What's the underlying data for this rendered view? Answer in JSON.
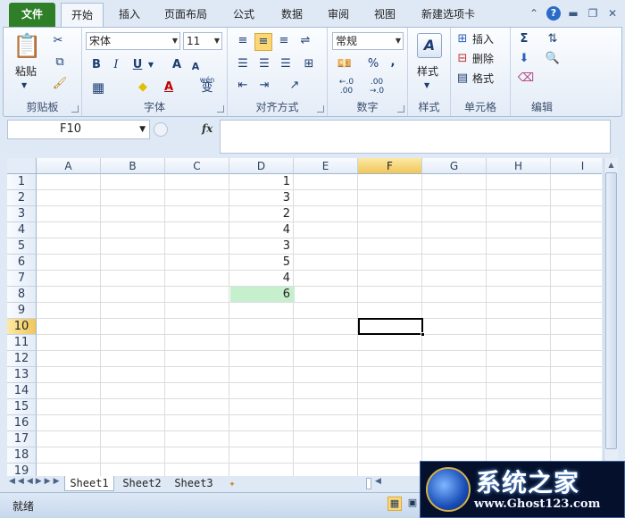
{
  "tabs": [
    "文件",
    "开始",
    "插入",
    "页面布局",
    "公式",
    "数据",
    "审阅",
    "视图",
    "新建选项卡"
  ],
  "active_tab": "开始",
  "window_controls": {
    "help": "?"
  },
  "ribbon": {
    "clipboard": {
      "label": "剪贴板",
      "paste": "粘贴"
    },
    "font": {
      "label": "字体",
      "font_name": "宋体",
      "font_size": "11",
      "bold": "B",
      "italic": "I",
      "underline": "U",
      "grow": "A",
      "shrink": "A",
      "wen": "wén",
      "wen_char": "变"
    },
    "alignment": {
      "label": "对齐方式"
    },
    "number": {
      "label": "数字",
      "format": "常规",
      "percent": "%",
      "comma": ",",
      "inc": "←.0 .00",
      "dec": ".00 →.0"
    },
    "styles": {
      "label": "样式",
      "button": "样式"
    },
    "cells": {
      "label": "单元格",
      "insert": "插入",
      "delete": "删除",
      "format": "格式"
    },
    "editing": {
      "label": "编辑",
      "sum": "Σ"
    }
  },
  "formula_bar": {
    "name_box": "F10",
    "fx": "fx",
    "value": ""
  },
  "columns": [
    "A",
    "B",
    "C",
    "D",
    "E",
    "F",
    "G",
    "H",
    "I"
  ],
  "selected_column": "F",
  "rows": [
    "1",
    "2",
    "3",
    "4",
    "5",
    "6",
    "7",
    "8",
    "9",
    "10",
    "11",
    "12",
    "13",
    "14",
    "15",
    "16",
    "17",
    "18",
    "19"
  ],
  "selected_row": "10",
  "column_d_values": [
    "1",
    "3",
    "2",
    "4",
    "3",
    "5",
    "4",
    "6"
  ],
  "highlight": {
    "cell": "D8",
    "color": "#c6efce"
  },
  "sheets": [
    "Sheet1",
    "Sheet2",
    "Sheet3"
  ],
  "active_sheet": "Sheet1",
  "status": {
    "ready": "就绪"
  },
  "watermark": {
    "title": "系统之家",
    "url": "www.Ghost123.com"
  }
}
